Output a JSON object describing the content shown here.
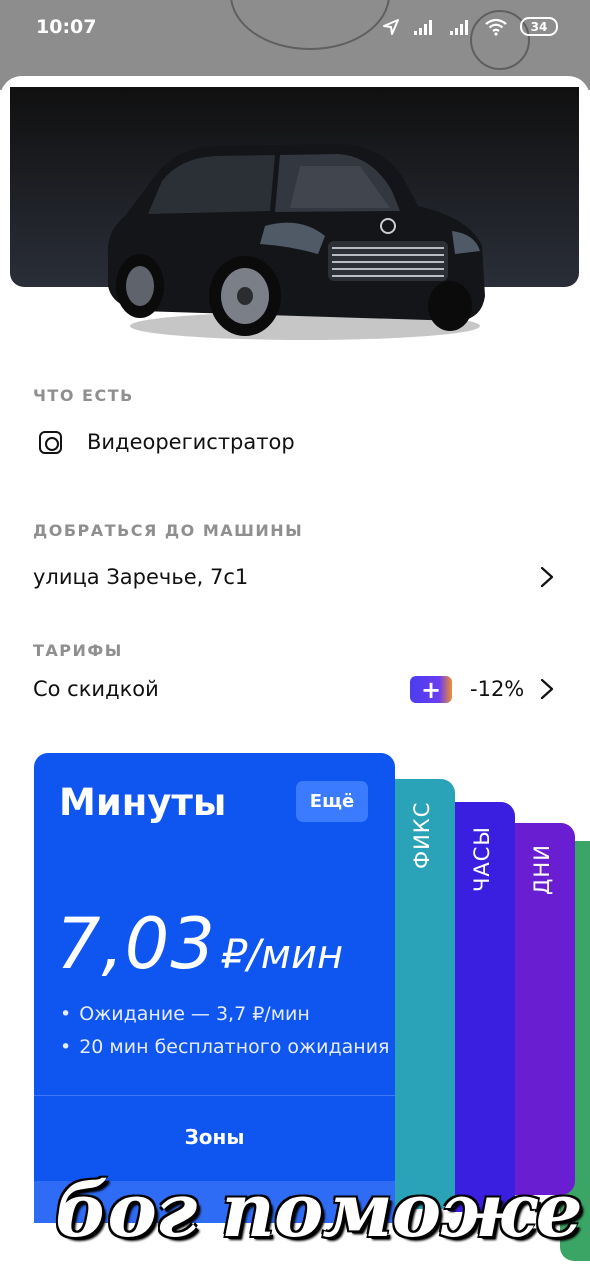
{
  "status_bar": {
    "time": "10:07",
    "battery": "34"
  },
  "features": {
    "section_title": "ЧТО ЕСТЬ",
    "items": [
      {
        "label": "Видеорегистратор",
        "icon": "dashcam-icon"
      }
    ]
  },
  "route": {
    "section_title": "ДОБРАТЬСЯ ДО МАШИНЫ",
    "address": "улица Заречье, 7с1"
  },
  "tariffs": {
    "section_title": "ТАРИФЫ",
    "discount_label": "Со скидкой",
    "discount_value": "-12%",
    "plus_badge": "+",
    "main_card": {
      "title": "Минуты",
      "more_label": "Ещё",
      "price": "7,03",
      "price_unit": "₽/мин",
      "bullets": [
        "Ожидание — 3,7 ₽/мин",
        "20 мин бесплатного ожидания"
      ],
      "zones_label": "Зоны"
    },
    "side_cards": [
      {
        "label": "ФИКС",
        "color": "#2aa3b8"
      },
      {
        "label": "ЧАСЫ",
        "color": "#3b1fe0"
      },
      {
        "label": "ДНИ",
        "color": "#6a1ed2"
      },
      {
        "label": "",
        "color": "#3aa564"
      }
    ]
  },
  "caption": "бог поможе"
}
